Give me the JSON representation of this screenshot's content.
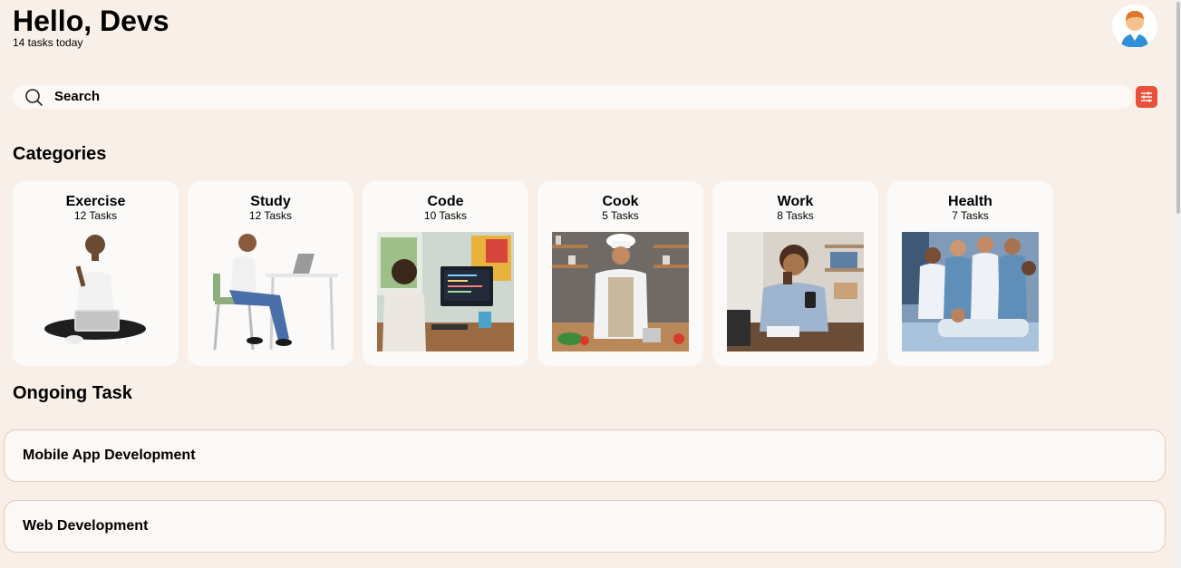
{
  "header": {
    "greeting": "Hello, Devs",
    "subtitle": "14 tasks today",
    "avatar_icon": "user-avatar-icon"
  },
  "search": {
    "label": "Search",
    "icon": "search-icon",
    "filter_icon": "sliders-icon",
    "filter_color": "#e8503a"
  },
  "categories": {
    "title": "Categories",
    "items": [
      {
        "name": "Exercise",
        "count": "12 Tasks",
        "image": "person-sitting-with-laptop"
      },
      {
        "name": "Study",
        "count": "12 Tasks",
        "image": "person-at-desk-with-laptop"
      },
      {
        "name": "Code",
        "count": "10 Tasks",
        "image": "developer-at-computer"
      },
      {
        "name": "Cook",
        "count": "5 Tasks",
        "image": "chef-in-kitchen"
      },
      {
        "name": "Work",
        "count": "8 Tasks",
        "image": "man-at-office-desk"
      },
      {
        "name": "Health",
        "count": "7 Tasks",
        "image": "medical-team-with-patient"
      }
    ]
  },
  "ongoing": {
    "title": "Ongoing Task",
    "items": [
      {
        "label": "Mobile App Development"
      },
      {
        "label": "Web Development"
      }
    ]
  },
  "colors": {
    "background": "#f7efe8",
    "card": "#fbfaf8",
    "accent": "#e8503a"
  }
}
